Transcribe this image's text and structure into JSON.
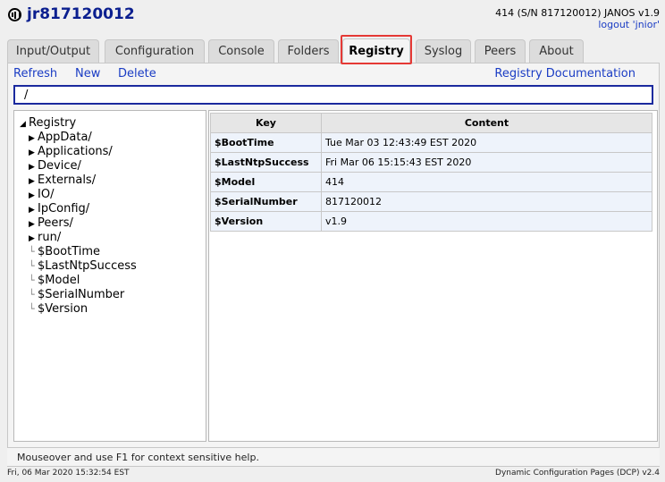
{
  "header": {
    "device_name": "jr817120012",
    "device_info": "414 (S/N 817120012) JANOS v1.9",
    "logout": "logout 'jnior'"
  },
  "tabs": [
    {
      "label": "Input/Output"
    },
    {
      "label": "Configuration"
    },
    {
      "label": "Console"
    },
    {
      "label": "Folders"
    },
    {
      "label": "Registry"
    },
    {
      "label": "Syslog"
    },
    {
      "label": "Peers"
    },
    {
      "label": "About"
    }
  ],
  "active_tab": "Registry",
  "toolbar": {
    "refresh": "Refresh",
    "new": "New",
    "delete": "Delete",
    "documentation": "Registry Documentation"
  },
  "path": {
    "value": "/"
  },
  "tree": {
    "root": "Registry",
    "folders": [
      "AppData/",
      "Applications/",
      "Device/",
      "Externals/",
      "IO/",
      "IpConfig/",
      "Peers/",
      "run/"
    ],
    "keys": [
      "$BootTime",
      "$LastNtpSuccess",
      "$Model",
      "$SerialNumber",
      "$Version"
    ]
  },
  "table": {
    "headers": {
      "key": "Key",
      "content": "Content"
    },
    "rows": [
      {
        "key": "$BootTime",
        "content": "Tue Mar 03 12:43:49 EST 2020"
      },
      {
        "key": "$LastNtpSuccess",
        "content": "Fri Mar 06 15:15:43 EST 2020"
      },
      {
        "key": "$Model",
        "content": "414"
      },
      {
        "key": "$SerialNumber",
        "content": "817120012"
      },
      {
        "key": "$Version",
        "content": "v1.9"
      }
    ]
  },
  "status": "Mouseover and use F1 for context sensitive help.",
  "footer": {
    "timestamp": "Fri, 06 Mar 2020 15:32:54 EST",
    "version": "Dynamic Configuration Pages (DCP) v2.4"
  },
  "colors": {
    "accent": "#1a3cc4",
    "title": "#0b1f8f",
    "highlight": "#e53935",
    "row_bg": "#eef3fb"
  }
}
